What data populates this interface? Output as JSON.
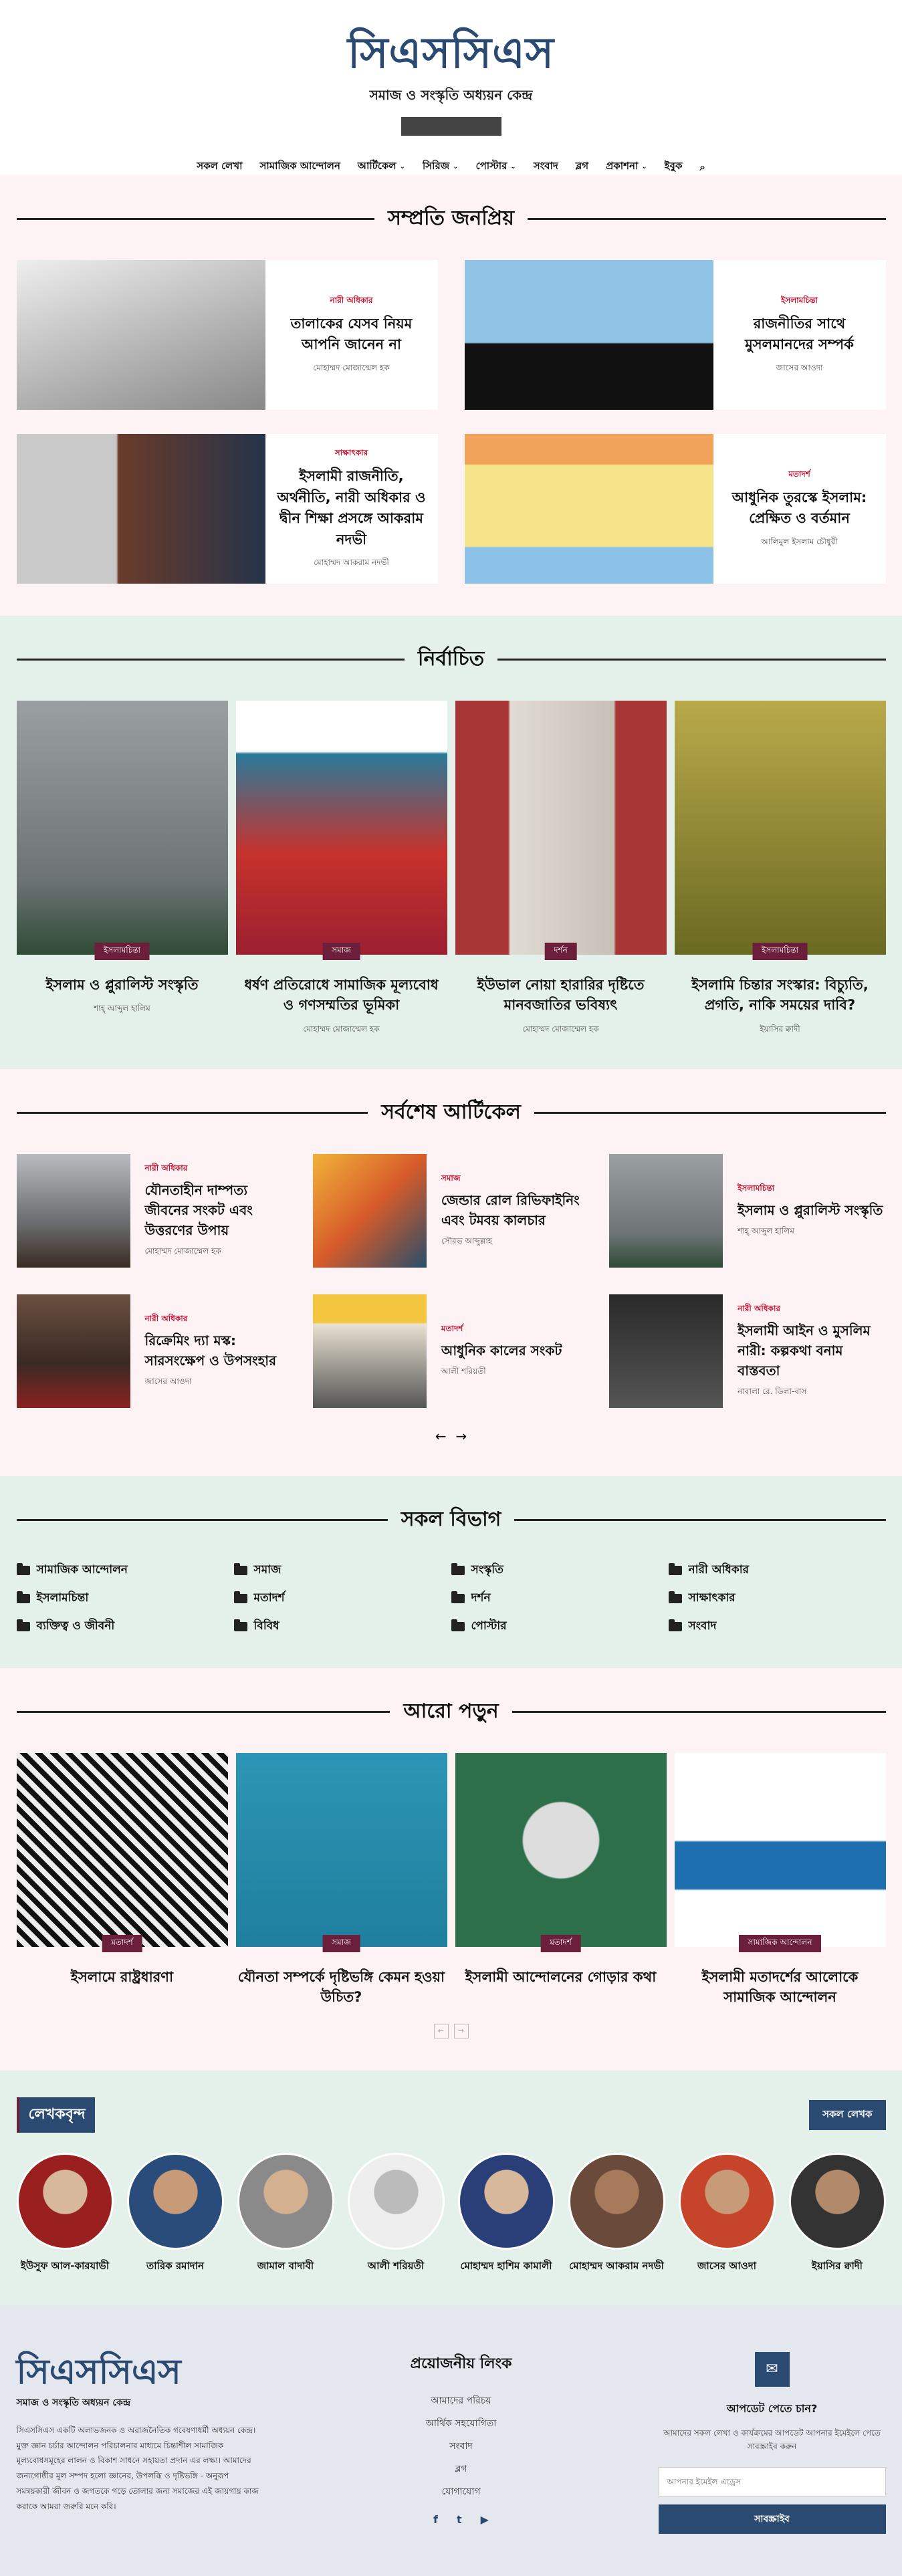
{
  "header": {
    "logo": "সিএসসিএস",
    "tagline": "সমাজ ও সংস্কৃতি অধ্যয়ন কেন্দ্র",
    "nav": [
      {
        "label": "সকল লেখা",
        "drop": false
      },
      {
        "label": "সামাজিক আন্দোলন",
        "drop": false
      },
      {
        "label": "আর্টিকেল",
        "drop": true
      },
      {
        "label": "সিরিজ",
        "drop": true
      },
      {
        "label": "পোস্টার",
        "drop": true
      },
      {
        "label": "সংবাদ",
        "drop": false
      },
      {
        "label": "ব্লগ",
        "drop": false
      },
      {
        "label": "প্রকাশনা",
        "drop": true
      },
      {
        "label": "ইবুক",
        "drop": false
      }
    ]
  },
  "popular": {
    "title": "সম্প্রতি জনপ্রিয়",
    "items": [
      {
        "cat": "নারী অধিকার",
        "title": "তালাকের যেসব নিয়ম আপনি জানেন না",
        "author": "মোহাম্মদ মোজাম্মেল হক",
        "img": "linear-gradient(160deg,#eee,#bbb 50%,#888)"
      },
      {
        "cat": "ইসলামচিন্তা",
        "title": "রাজনীতির সাথে মুসলমানদের সম্পর্ক",
        "author": "জাসের আওদা",
        "img": "linear-gradient(180deg,#8fc3e6 55%,#111 56%)"
      },
      {
        "cat": "সাক্ষাৎকার",
        "title": "ইসলামী রাজনীতি, অর্থনীতি, নারী অধিকার ও দ্বীন শিক্ষা প্রসঙ্গে আকরাম নদভী",
        "author": "মোহাম্মদ আকরাম নদভী",
        "img": "linear-gradient(90deg,#c9c9c9 40%,#6a3b2a 41%,#25334a)"
      },
      {
        "cat": "মতাদর্শ",
        "title": "আধুনিক তুরস্কে ইসলাম: প্রেক্ষিত ও বর্তমান",
        "author": "আলিমুল ইসলাম চৌধুরী",
        "img": "linear-gradient(180deg,#f2a35a 20%,#f5e48a 21%,#f5e48a 75%,#8cc2e8 76%)"
      }
    ]
  },
  "featured": {
    "title": "নির্বাচিত",
    "items": [
      {
        "badge": "ইসলামচিন্তা",
        "title": "ইসলাম ও প্লুরালিস্ট সংস্কৃতি",
        "author": "শাহ্ আব্দুল হালিম",
        "img": "linear-gradient(180deg,#9a9fa1,#6e7476 70%,#2f4b36)"
      },
      {
        "badge": "সমাজ",
        "title": "ধর্ষণ প্রতিরোধে সামাজিক মূল্যবোধ ও গণসম্মতির ভূমিকা",
        "author": "মোহাম্মদ মোজাম্মেল হক",
        "img": "linear-gradient(180deg,#fff 20%,#2a7a9a 21%,#c7322c 60%,#9b2030)"
      },
      {
        "badge": "দর্শন",
        "title": "ইউভাল নোয়া হারারির দৃষ্টিতে মানবজাতির ভবিষ্যৎ",
        "author": "মোহাম্মদ মোজাম্মেল হক",
        "img": "linear-gradient(90deg,#a93636 25%,#e0dbd4 26%,#c7c0b8 75%,#a93636 76%)"
      },
      {
        "badge": "ইসলামচিন্তা",
        "title": "ইসলামি চিন্তার সংস্কার: বিচ্যুতি, প্রগতি, নাকি সময়ের দাবি?",
        "author": "ইয়াসির ক্বাদী",
        "img": "linear-gradient(180deg,#b9a94a,#6a6a22)"
      }
    ]
  },
  "latest": {
    "title": "সর্বশেষ আর্টিকেল",
    "items": [
      {
        "cat": "নারী অধিকার",
        "title": "যৌনতাহীন দাম্পত্য জীবনের সংকট এবং উত্তরণের উপায়",
        "author": "মোহাম্মদ মোজাম্মেল হক",
        "img": "linear-gradient(180deg,#b8bcc0,#6b6e70 60%,#3b2c22)"
      },
      {
        "cat": "সমাজ",
        "title": "জেন্ডার রোল রিভিফাইনিং এবং টমবয় কালচার",
        "author": "সৌরভ আব্দুল্লাহ",
        "img": "linear-gradient(135deg,#f1b23a,#d75b2a 50%,#2a4d6a)"
      },
      {
        "cat": "ইসলামচিন্তা",
        "title": "ইসলাম ও প্লুরালিস্ট সংস্কৃতি",
        "author": "শাহ্ আব্দুল হালিম",
        "img": "linear-gradient(180deg,#9a9fa1,#6e7476 70%,#2f4b36)"
      },
      {
        "cat": "নারী অধিকার",
        "title": "রিক্রেমিং দ্যা মস্ক: সারসংক্ষেপ ও উপসংহার",
        "author": "জাসের আওদা",
        "img": "linear-gradient(180deg,#6b5040,#3a2a24 60%,#8a2222)"
      },
      {
        "cat": "মতাদর্শ",
        "title": "আধুনিক কালের সংকট",
        "author": "আলী শরিয়তী",
        "img": "linear-gradient(180deg,#f4c640 25%,#e9e2d2 26%,#555)"
      },
      {
        "cat": "নারী অধিকার",
        "title": "ইসলামী আইন ও মুসলিম নারী: কল্পকথা বনাম বাস্তবতা",
        "author": "নাবালা রে. ডিলা-বাস",
        "img": "linear-gradient(180deg,#2a2a2a,#555)"
      }
    ]
  },
  "categories": {
    "title": "সকল বিভাগ",
    "items": [
      "সামাজিক আন্দোলন",
      "সমাজ",
      "সংস্কৃতি",
      "নারী অধিকার",
      "ইসলামচিন্তা",
      "মতাদর্শ",
      "দর্শন",
      "সাক্ষাৎকার",
      "ব্যক্তিত্ব ও জীবনী",
      "বিবিধ",
      "পোস্টার",
      "সংবাদ"
    ]
  },
  "more": {
    "title": "আরো পড়ুন",
    "items": [
      {
        "badge": "মতাদর্শ",
        "title": "ইসলামে রাষ্ট্রধারণা",
        "img": "repeating-linear-gradient(45deg,#111 0 8px,#eee 8px 16px)"
      },
      {
        "badge": "সমাজ",
        "title": "যৌনতা সম্পর্কে দৃষ্টিভঙ্গি কেমন হওয়া উচিত?",
        "img": "linear-gradient(180deg,#2d95b5,#1f7f9e)"
      },
      {
        "badge": "মতাদর্শ",
        "title": "ইসলামী আন্দোলনের গোড়ার কথা",
        "img": "radial-gradient(circle at 50% 45%,#ddd 25%,#2d6f4a 26%)"
      },
      {
        "badge": "সামাজিক আন্দোলন",
        "title": "ইসলামী মতাদর্শের আলোকে সামাজিক আন্দোলন",
        "img": "linear-gradient(180deg,#fff 45%,#1e6fb0 46%,#1e6fb0 70%,#fff 71%)"
      }
    ]
  },
  "writers": {
    "title": "লেখকবৃন্দ",
    "all": "সকল লেখক",
    "items": [
      {
        "name": "ইউসুফ আল-কারযাভী",
        "img": "radial-gradient(circle at 50% 40%,#d8b89a 30%,#9a1f1f 31%)"
      },
      {
        "name": "তারিক রমাদান",
        "img": "radial-gradient(circle at 50% 40%,#c79a78 30%,#2a4c7a 31%)"
      },
      {
        "name": "জামাল বাদাবী",
        "img": "radial-gradient(circle at 50% 40%,#d2b090 30%,#8a8a8a 31%)"
      },
      {
        "name": "আলী শরিয়তী",
        "img": "radial-gradient(circle at 50% 40%,#bbb 30%,#eee 31%)"
      },
      {
        "name": "মোহাম্মদ হাশিম কামালী",
        "img": "radial-gradient(circle at 50% 40%,#d8b89a 30%,#2a3f78 31%)"
      },
      {
        "name": "মোহাম্মদ আকরাম নদভী",
        "img": "radial-gradient(circle at 50% 40%,#a67a5a 30%,#6a4a3a 31%)"
      },
      {
        "name": "জাসের আওদা",
        "img": "radial-gradient(circle at 50% 40%,#c79a78 30%,#c6452a 31%)"
      },
      {
        "name": "ইয়াসির ক্বাদী",
        "img": "radial-gradient(circle at 50% 40%,#b08a6a 30%,#333 31%)"
      }
    ]
  },
  "footer": {
    "logo": "সিএসসিএস",
    "tagline": "সমাজ ও সংস্কৃতি অধ্যয়ন কেন্দ্র",
    "about": "সিএসসিএস একটি অলাভজনক ও অরাজনৈতিক গবেষণাধর্মী অধ্যয়ন কেন্দ্র। মুক্ত জ্ঞান চর্চার আন্দোলন পরিচালনার মাধ্যমে চিন্তাশীল সামাজিক মূল্যবোধসমূহের লালন ও বিকাশ সাধনে সহায়তা প্রদান এর লক্ষ্য। আমাদের জন্যগোষ্ঠীর মূল সম্পদ হলো জ্ঞানের, উপলব্ধি ও দৃষ্টিভঙ্গি - অনুরূপ সমন্বয়কারী জীবন ও জগতকে গড়ে তোলার জন্য সমাজের এই জায়গায় কাজ করাকে আমরা জরুরি মনে করি।",
    "links_title": "প্রয়োজনীয় লিংক",
    "links": [
      "আমাদের পরিচয়",
      "আর্থিক সহযোগিতা",
      "সংবাদ",
      "ব্লগ",
      "যোগাযোগ"
    ],
    "social": [
      "f",
      "t",
      "▶"
    ],
    "sub_title": "আপডেট পেতে চান?",
    "sub_text": "আমাদের সকল লেখা ও কার্যক্রমের আপডেট আপনার ইমেইলে পেতে সাবস্ক্রাইব করুন",
    "email_placeholder": "আপনার ইমেইল এড্রেস",
    "subscribe": "সাবস্ক্রাইব"
  }
}
